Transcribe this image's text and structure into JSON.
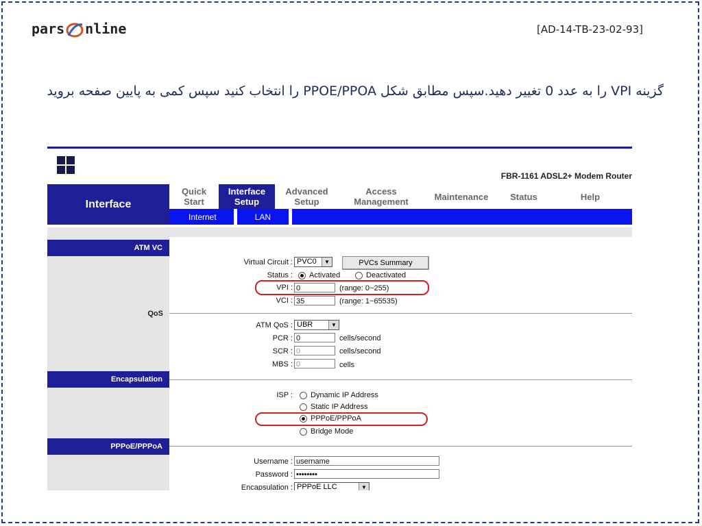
{
  "slide": {
    "brand": "pars online",
    "brand_a": "pars",
    "brand_b": "nline",
    "doc_code": "[AD-14-TB-23-02-93]",
    "instruction": "گزینه VPI را به عدد 0 تغییر دهید.سپس مطابق شکل PPOE/PPOA را انتخاب کنید سپس کمی به پایین صفحه بروید"
  },
  "router": {
    "model": "FBR-1161 ADSL2+ Modem Router",
    "section_title": "Interface",
    "tabs": [
      {
        "label_1": "Quick",
        "label_2": "Start"
      },
      {
        "label_1": "Interface",
        "label_2": "Setup"
      },
      {
        "label_1": "Advanced",
        "label_2": "Setup"
      },
      {
        "label_1": "Access",
        "label_2": "Management"
      },
      {
        "label_1": "Maintenance",
        "label_2": ""
      },
      {
        "label_1": "Status",
        "label_2": ""
      },
      {
        "label_1": "Help",
        "label_2": ""
      }
    ],
    "subtabs": [
      "Internet",
      "LAN"
    ],
    "sections": {
      "atm_vc": "ATM VC",
      "qos": "QoS",
      "encapsulation": "Encapsulation",
      "pppoe": "PPPoE/PPPoA"
    },
    "atm": {
      "virtual_circuit_label": "Virtual Circuit :",
      "virtual_circuit_value": "PVC0",
      "pvcs_summary_button": "PVCs Summary",
      "status_label": "Status :",
      "status_activated": "Activated",
      "status_deactivated": "Deactivated",
      "vpi_label": "VPI :",
      "vpi_value": "0",
      "vpi_range": "(range: 0~255)",
      "vci_label": "VCI :",
      "vci_value": "35",
      "vci_range": "(range: 1~65535)"
    },
    "qos": {
      "atm_qos_label": "ATM QoS :",
      "atm_qos_value": "UBR",
      "pcr_label": "PCR :",
      "pcr_value": "0",
      "scr_label": "SCR :",
      "scr_value": "0",
      "mbs_label": "MBS :",
      "mbs_value": "0",
      "cells_per_second": "cells/second",
      "cells": "cells"
    },
    "encapsulation": {
      "isp_label": "ISP :",
      "options": [
        "Dynamic IP Address",
        "Static IP Address",
        "PPPoE/PPPoA",
        "Bridge Mode"
      ],
      "selected": "PPPoE/PPPoA"
    },
    "pppoe": {
      "username_label": "Username :",
      "username_value": "username",
      "password_label": "Password :",
      "password_value": "••••••••",
      "encap_label": "Encapsulation :",
      "encap_value": "PPPoE LLC"
    },
    "colors": {
      "nav_blue": "#1e1e96",
      "subnav_blue": "#0a14f0",
      "highlight_red": "#d42020"
    }
  }
}
